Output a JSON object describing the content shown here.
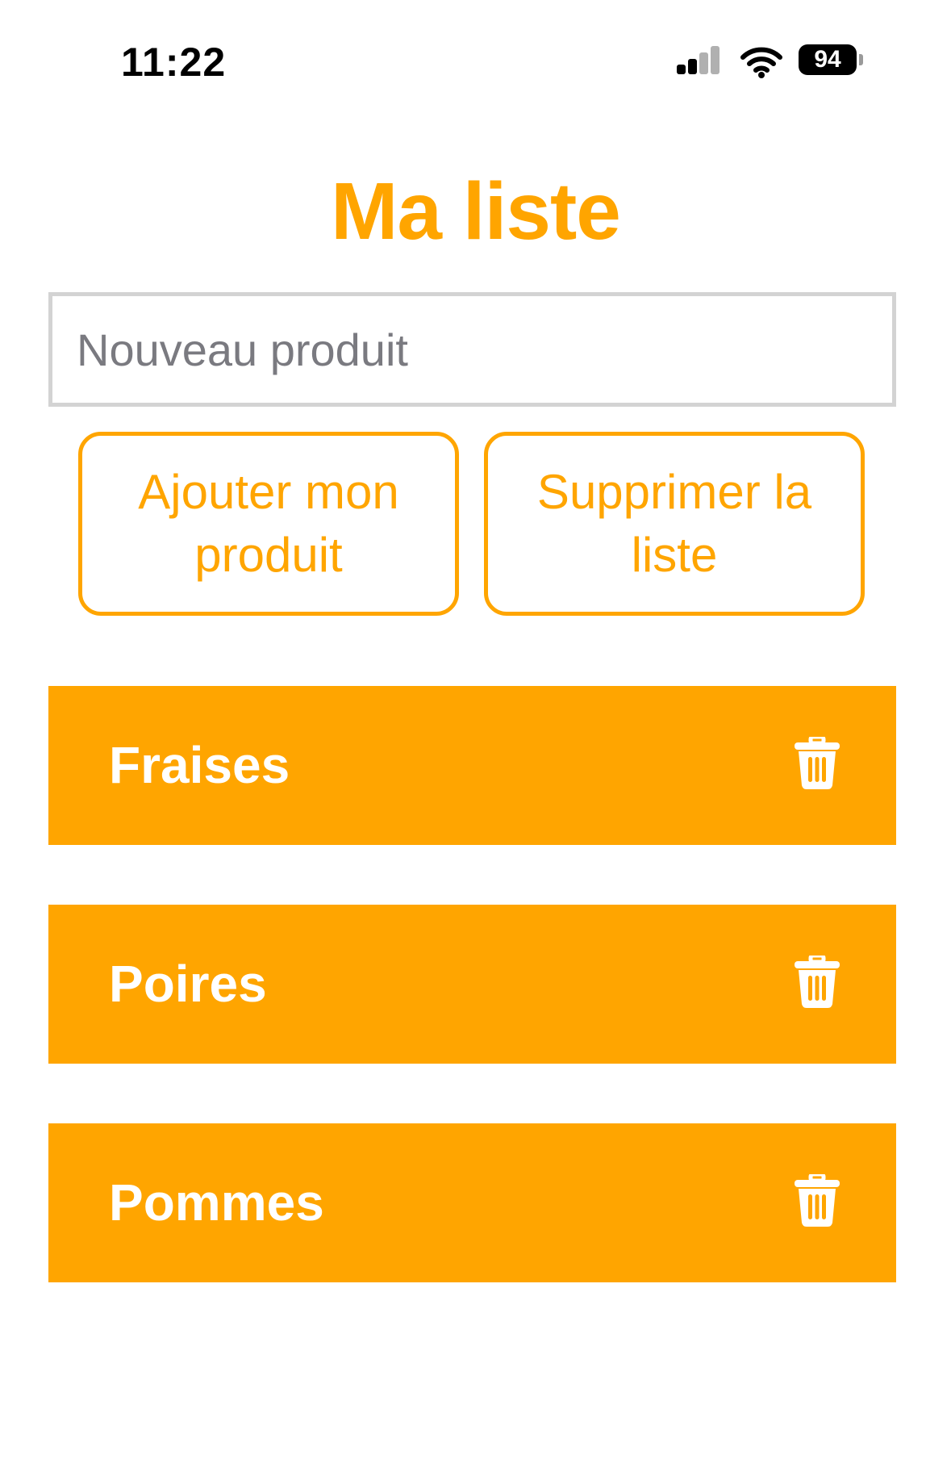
{
  "status_bar": {
    "time": "11:22",
    "battery": "94",
    "signal_icon": "cellular-signal-icon",
    "wifi_icon": "wifi-icon"
  },
  "title": "Ma liste",
  "input": {
    "placeholder": "Nouveau produit",
    "value": ""
  },
  "buttons": {
    "add": "Ajouter mon produit",
    "clear": "Supprimer la liste"
  },
  "list": {
    "items": [
      {
        "label": "Fraises",
        "icon": "trash-icon"
      },
      {
        "label": "Poires",
        "icon": "trash-icon"
      },
      {
        "label": "Pommes",
        "icon": "trash-icon"
      }
    ]
  },
  "colors": {
    "accent": "#FFA500",
    "input_border": "#D3D3D3",
    "item_text": "#FFFFFF"
  }
}
